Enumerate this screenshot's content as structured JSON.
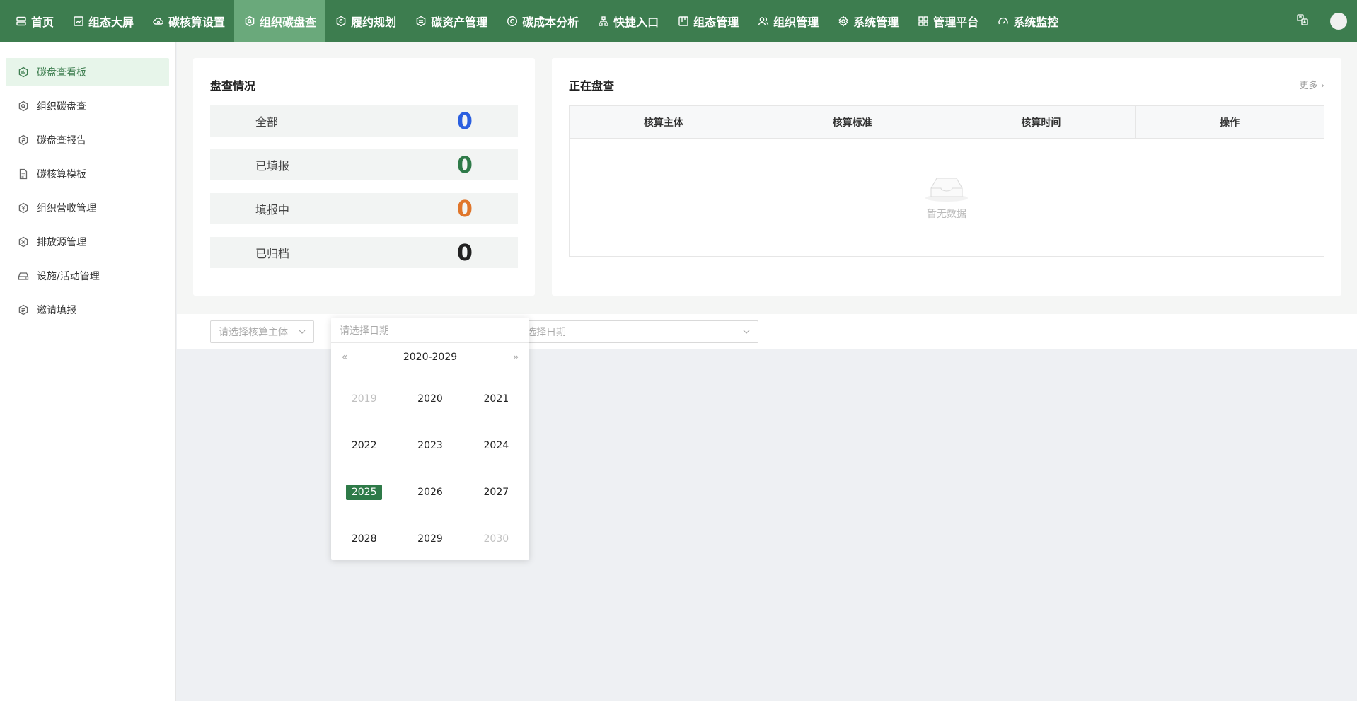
{
  "nav": {
    "items": [
      {
        "label": "首页",
        "icon": "server-icon"
      },
      {
        "label": "组态大屏",
        "icon": "chart-line-icon"
      },
      {
        "label": "碳核算设置",
        "icon": "cloud-gear-icon"
      },
      {
        "label": "组织碳盘查",
        "icon": "search-circle-icon",
        "active": true
      },
      {
        "label": "履约规划",
        "icon": "copyright-icon"
      },
      {
        "label": "碳资产管理",
        "icon": "hexagon-icon"
      },
      {
        "label": "碳成本分析",
        "icon": "copyright-icon"
      },
      {
        "label": "快捷入口",
        "icon": "sitemap-icon"
      },
      {
        "label": "组态管理",
        "icon": "board-icon"
      },
      {
        "label": "组织管理",
        "icon": "users-icon"
      },
      {
        "label": "系统管理",
        "icon": "gear-icon"
      },
      {
        "label": "管理平台",
        "icon": "grid-icon"
      },
      {
        "label": "系统监控",
        "icon": "dashboard-icon"
      }
    ]
  },
  "sidebar": {
    "items": [
      {
        "label": "碳盘查看板",
        "active": true
      },
      {
        "label": "组织碳盘查"
      },
      {
        "label": "碳盘查报告"
      },
      {
        "label": "碳核算模板"
      },
      {
        "label": "组织营收管理"
      },
      {
        "label": "排放源管理"
      },
      {
        "label": "设施/活动管理"
      },
      {
        "label": "邀请填报"
      }
    ]
  },
  "overview": {
    "title": "盘查情况",
    "stats": [
      {
        "label": "全部",
        "value": "0",
        "color": "#2b5fe0"
      },
      {
        "label": "已填报",
        "value": "0",
        "color": "#2e7a48"
      },
      {
        "label": "填报中",
        "value": "0",
        "color": "#e0762b"
      },
      {
        "label": "已归档",
        "value": "0",
        "color": "#222222"
      }
    ]
  },
  "ongoing": {
    "title": "正在盘查",
    "more": "更多",
    "columns": [
      "核算主体",
      "核算标准",
      "核算时间",
      "操作"
    ],
    "empty_text": "暂无数据"
  },
  "filters": {
    "entity_placeholder": "请选择核算主体",
    "date_placeholder": "请选择日期"
  },
  "picker": {
    "input_placeholder": "请选择日期",
    "range_label": "2020-2029",
    "years": [
      "2019",
      "2020",
      "2021",
      "2022",
      "2023",
      "2024",
      "2025",
      "2026",
      "2027",
      "2028",
      "2029",
      "2030"
    ],
    "selected": "2025"
  },
  "colors": {
    "primary": "#3d7d4f",
    "nav_active": "#6aa97b",
    "selected_year": "#2e7a48"
  }
}
